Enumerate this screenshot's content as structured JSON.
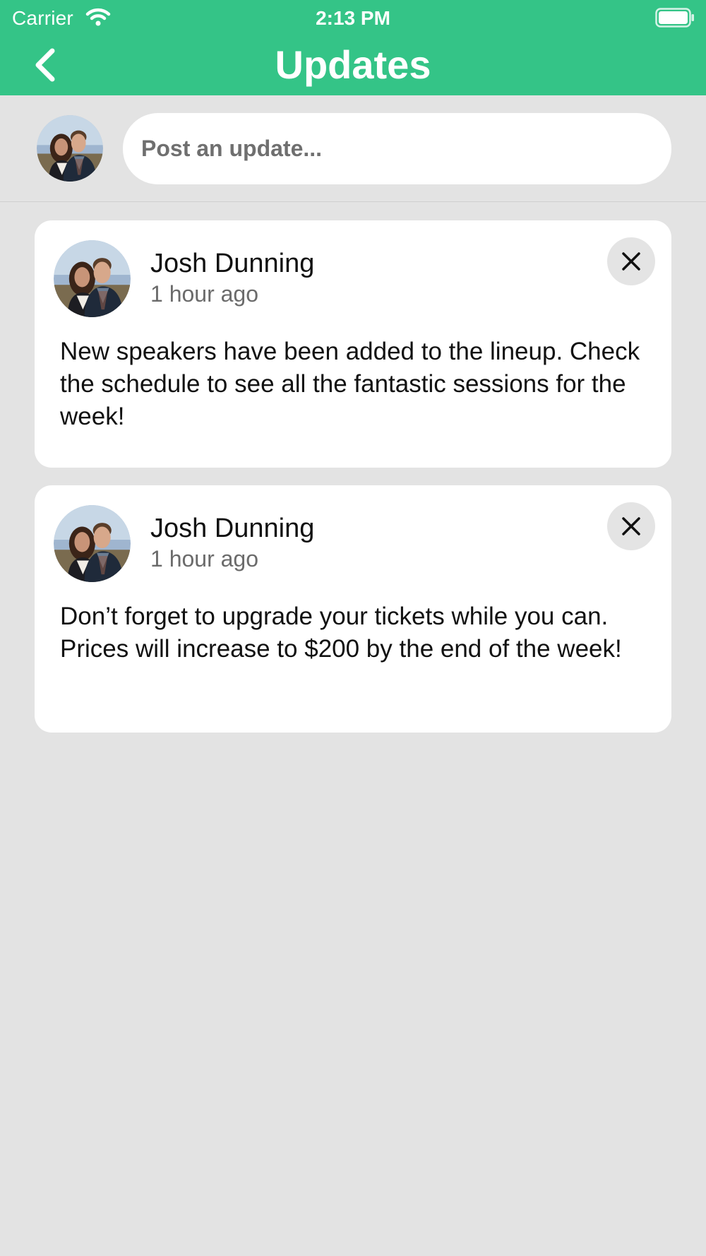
{
  "status_bar": {
    "carrier": "Carrier",
    "time": "2:13 PM",
    "wifi_icon": "wifi-icon",
    "battery_icon": "battery-icon"
  },
  "header": {
    "title": "Updates",
    "back_icon": "chevron-left-icon",
    "background_color": "#34c487"
  },
  "composer": {
    "placeholder": "Post an update...",
    "value": ""
  },
  "posts": [
    {
      "author": "Josh Dunning",
      "time": "1 hour ago",
      "body": "New speakers have been added to the lineup. Check the schedule to see all the fantastic sessions for the week!",
      "dismiss_icon": "close-icon"
    },
    {
      "author": "Josh Dunning",
      "time": "1 hour ago",
      "body": "Don’t forget to upgrade your tickets while you can. Prices will increase to $200 by the end of the week!",
      "dismiss_icon": "close-icon"
    }
  ],
  "colors": {
    "accent": "#34c487",
    "background": "#e3e3e3",
    "card": "#ffffff"
  }
}
